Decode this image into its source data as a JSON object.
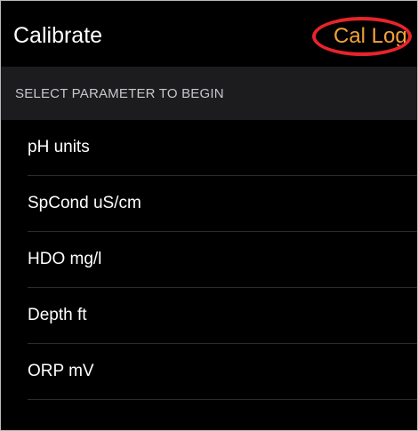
{
  "navbar": {
    "title": "Calibrate",
    "action_label": "Cal Log",
    "highlight_color": "#e8242b",
    "action_color": "#f2a238"
  },
  "section": {
    "header": "SELECT PARAMETER TO BEGIN"
  },
  "parameters": [
    {
      "label": "pH units"
    },
    {
      "label": "SpCond uS/cm"
    },
    {
      "label": "HDO mg/l"
    },
    {
      "label": "Depth ft"
    },
    {
      "label": "ORP mV"
    }
  ]
}
